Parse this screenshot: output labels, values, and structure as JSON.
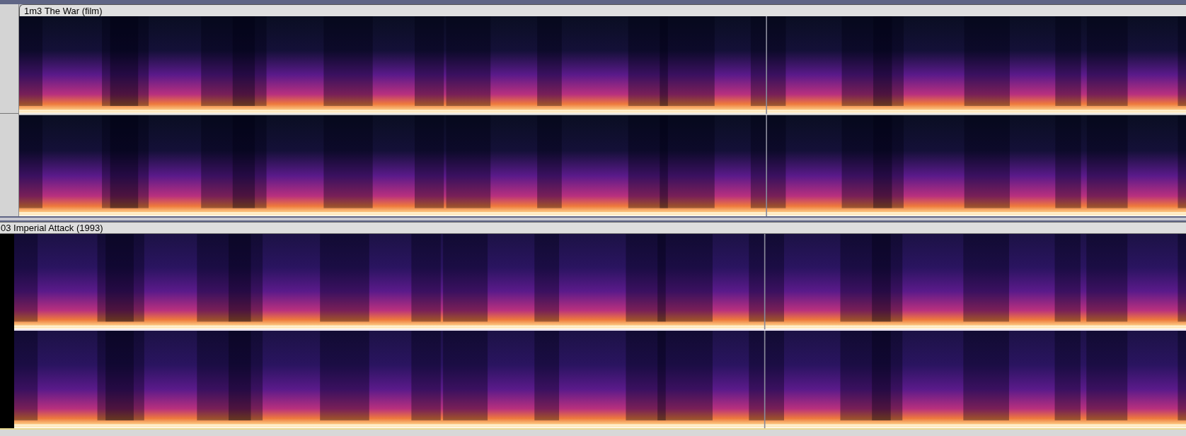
{
  "tracks": [
    {
      "name": "1m3 The War (film)",
      "kind": "tab"
    },
    {
      "name": "03 Imperial Attack (1993)",
      "kind": "bar"
    }
  ]
}
